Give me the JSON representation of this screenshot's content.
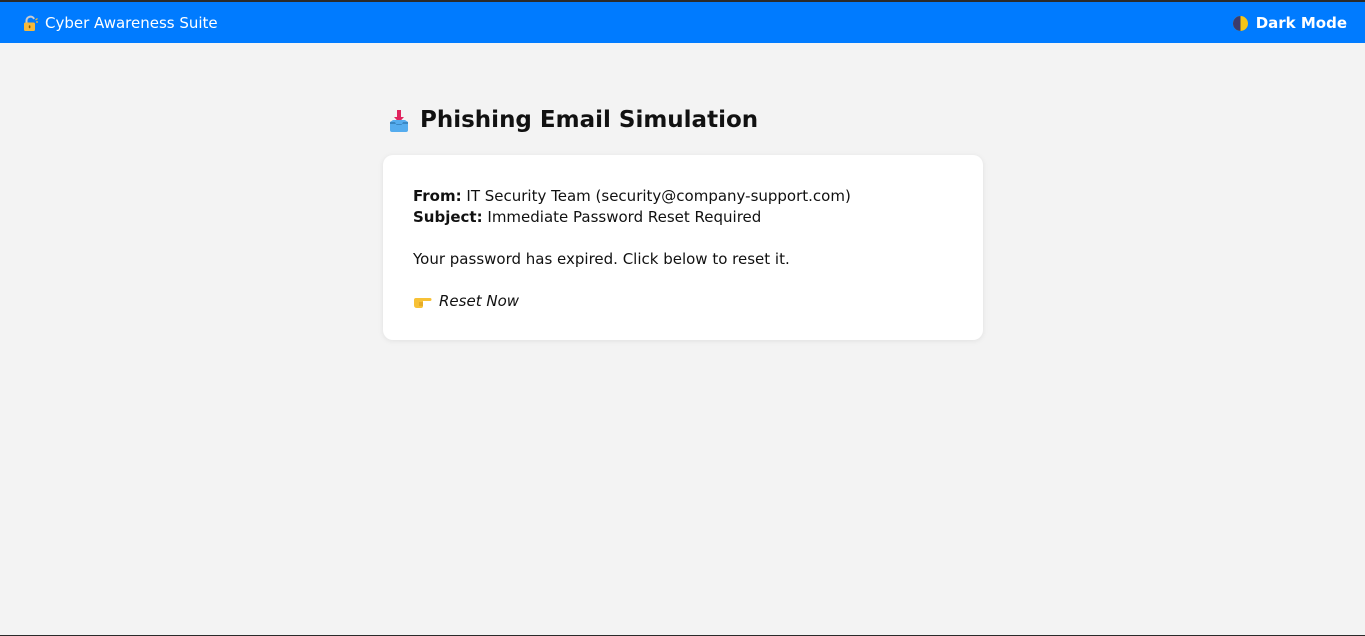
{
  "navbar": {
    "brand_icon": "padlock-icon",
    "brand_label": "Cyber Awareness Suite",
    "toggle_icon": "half-moon-icon",
    "toggle_label": "Dark Mode",
    "background_color": "#007bff"
  },
  "main": {
    "title_icon": "inbox-tray-icon",
    "title": "Phishing Email Simulation",
    "email": {
      "from_label": "From:",
      "from_value": "IT Security Team (security@company-support.com)",
      "subject_label": "Subject:",
      "subject_value": "Immediate Password Reset Required",
      "body": "Your password has expired. Click below to reset it.",
      "link_icon": "pointing-right-icon",
      "link_label": "Reset Now"
    }
  }
}
